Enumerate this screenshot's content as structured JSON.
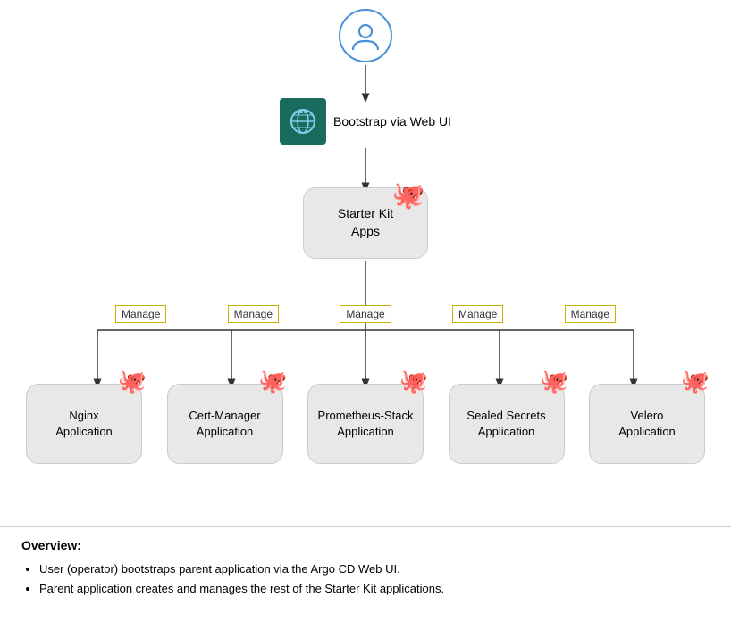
{
  "diagram": {
    "user_icon_title": "User",
    "webui_label": "Bootstrap via Web UI",
    "starter_kit_label": "Starter Kit\nApps",
    "manage_label": "Manage",
    "apps": [
      {
        "label": "Nginx\nApplication",
        "id": "nginx"
      },
      {
        "label": "Cert-Manager\nApplication",
        "id": "cert-manager"
      },
      {
        "label": "Prometheus-Stack\nApplication",
        "id": "prometheus"
      },
      {
        "label": "Sealed Secrets\nApplication",
        "id": "sealed-secrets"
      },
      {
        "label": "Velero\nApplication",
        "id": "velero"
      }
    ]
  },
  "overview": {
    "title": "Overview:",
    "items": [
      "User (operator) bootstraps parent application via the Argo CD Web UI.",
      "Parent application creates and manages the rest of the Starter Kit applications."
    ]
  },
  "colors": {
    "webui_bg": "#1a6b5e",
    "user_border": "#4a90d9",
    "manage_border": "#c8b400",
    "box_bg": "#e8e8e8"
  }
}
